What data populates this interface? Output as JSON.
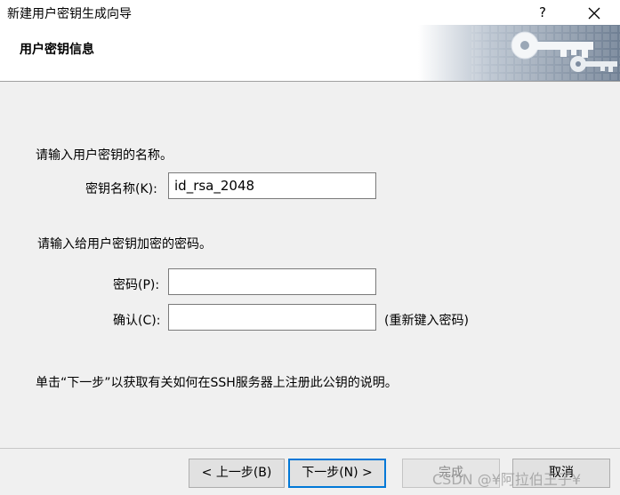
{
  "window": {
    "title": "新建用户密钥生成向导",
    "help_label": "?",
    "close_icon": "close-icon"
  },
  "header": {
    "title": "用户密钥信息",
    "art_icon": "keys-icon"
  },
  "form": {
    "name_prompt": "请输入用户密钥的名称。",
    "name_label": "密钥名称(K):",
    "name_value": "id_rsa_2048",
    "pass_prompt": "请输入给用户密钥加密的密码。",
    "password_label": "密码(P):",
    "password_value": "",
    "confirm_label": "确认(C):",
    "confirm_value": "",
    "confirm_hint": "(重新键入密码)",
    "note": "单击“下一步”以获取有关如何在SSH服务器上注册此公钥的说明。"
  },
  "buttons": {
    "back": "< 上一步(B)",
    "next": "下一步(N) >",
    "finish": "完成",
    "cancel": "取消"
  },
  "watermark": "CSDN @¥阿拉伯王子¥"
}
